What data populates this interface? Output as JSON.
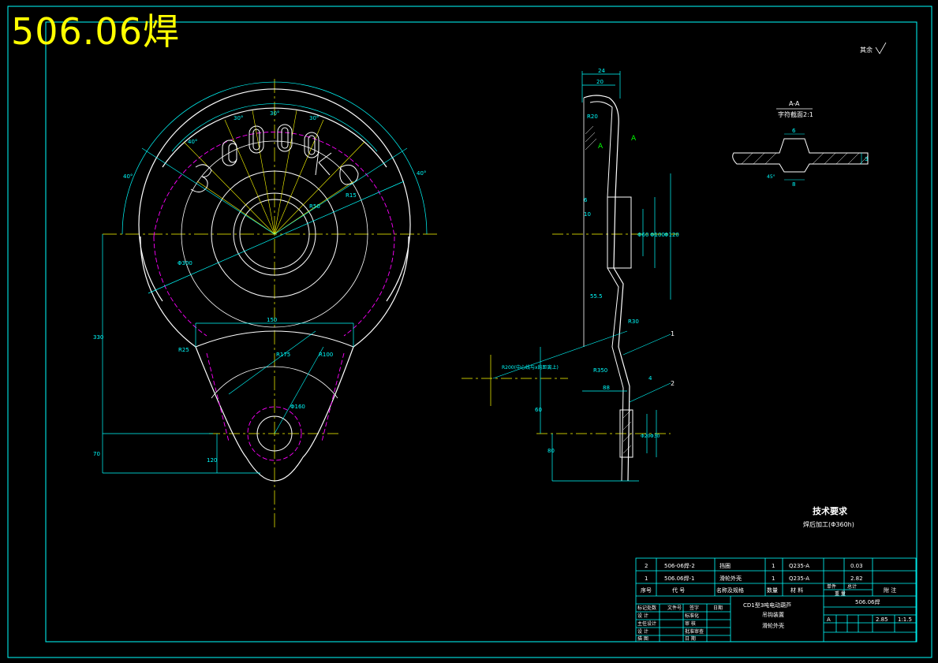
{
  "drawing": {
    "big_title": "506.06焊",
    "roughness_note": "其余",
    "section_title": "A-A",
    "section_subtitle": "字符截面2:1",
    "section_marker": "A",
    "tech_req_title": "技术要求",
    "tech_req_note": "焊后加工(Φ360h)",
    "front_dims": {
      "angle_40a": "40°",
      "angle_30a": "30°",
      "angle_30b": "30°",
      "angle_30c": "30°",
      "angle_40b": "40°",
      "angle_40c": "40°",
      "dia_300": "Φ300",
      "r15": "R15",
      "r50": "R50",
      "width_150": "150",
      "r175": "R175",
      "height_330": "330",
      "height_120": "120",
      "height_70": "70",
      "r25": "R25",
      "r100": "R100",
      "dia_160": "Φ160"
    },
    "side_dims": {
      "d24": "24",
      "d20": "20",
      "r20": "R20",
      "d6": "6",
      "d10": "10",
      "dia_60": "Φ60",
      "dia_100": "Φ100",
      "dia_120": "Φ120",
      "d5": "55.5",
      "r30": "R30",
      "r200": "R200(中心线与x的距离上)",
      "r350": "R350",
      "d88": "88",
      "d4": "4",
      "d60": "60",
      "d80": "80",
      "dia_20": "Φ20",
      "dia_30": "Φ30",
      "leader_1": "1",
      "leader_2": "2"
    },
    "section_dims": {
      "d6": "6",
      "d8": "8",
      "d3": "3",
      "d45": "45°"
    }
  },
  "bom": {
    "rows": [
      {
        "seq": "2",
        "code": "506-06焊-2",
        "name": "挡圈",
        "qty": "1",
        "material": "Q235-A",
        "single": "",
        "weight": "0.03",
        "note": ""
      },
      {
        "seq": "1",
        "code": "506.06焊-1",
        "name": "滑轮外壳",
        "qty": "1",
        "material": "Q235-A",
        "single": "",
        "weight": "2.82",
        "note": ""
      }
    ],
    "header": {
      "seq": "序号",
      "code": "代 号",
      "name": "名称及规格",
      "qty": "数量",
      "material": "材 料",
      "single": "单件",
      "total": "总计",
      "weight_label": "重 量",
      "note": "附 注"
    }
  },
  "title_block": {
    "project_line1": "CD1型3吨电动葫芦",
    "project_line2": "吊钩装置",
    "part_name": "滑轮外壳",
    "drawing_no": "506.06焊",
    "weight": "2.85",
    "scale": "1:1.5",
    "stage_mark": "A",
    "sig_labels": [
      "标记处数",
      "文件号",
      "签字",
      "日期"
    ],
    "roles": [
      {
        "left": "设 计",
        "mid": "标准化"
      },
      {
        "left": "主任设计",
        "mid": "审 核"
      },
      {
        "left": "设 计",
        "mid": "批准审查"
      },
      {
        "left": "描 图",
        "mid": "日 期"
      }
    ]
  },
  "colors": {
    "frame": "#00ffff",
    "outline": "#ffffff",
    "center": "#ffff00",
    "hidden": "#ff00ff",
    "green": "#00ff00",
    "title": "#ffff00"
  }
}
